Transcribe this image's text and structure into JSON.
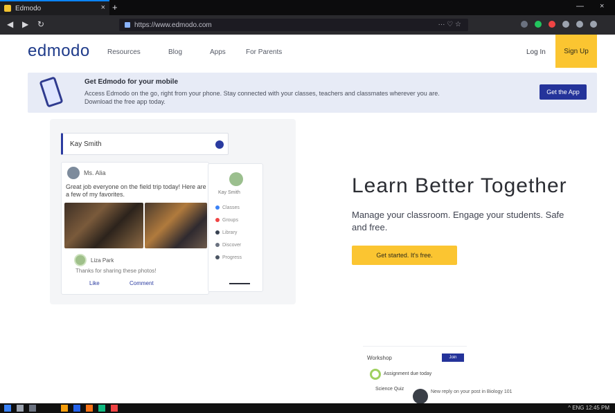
{
  "browser": {
    "tab_title": "Edmodo",
    "tab_close": "×",
    "new_tab": "+",
    "window_min": "—",
    "window_close": "×",
    "back": "◀",
    "forward": "▶",
    "reload": "↻",
    "url": "https://www.edmodo.com",
    "url_actions": "··· ♡ ☆"
  },
  "header": {
    "logo": "edmodo",
    "nav_links": [
      "Resources",
      "Blog",
      "Apps",
      "For Parents"
    ],
    "login": "Log In",
    "signup": "Sign Up"
  },
  "banner": {
    "title": "Get Edmodo for your mobile",
    "text": "Access Edmodo on the go, right from your phone. Stay connected with your classes, teachers and classmates wherever you are. Download the free app today.",
    "button": "Get the App"
  },
  "mock": {
    "search_text": "Kay Smith",
    "post_name": "Ms. Alia",
    "post_text": "Great job everyone on the field trip today! Here are a few of my favorites.",
    "comment_name": "Liza Park",
    "comment_text": "Thanks for sharing these photos!",
    "action_like": "Like",
    "action_comment": "Comment",
    "side_name": "Kay Smith",
    "side_items": [
      "Classes",
      "Groups",
      "Library",
      "Discover",
      "Progress"
    ]
  },
  "hero": {
    "title": "Learn Better Together",
    "subtitle": "Manage your classroom. Engage your students. Safe and free.",
    "button": "Get started. It's free."
  },
  "bottom": {
    "title": "Workshop",
    "badge": "Join",
    "ring_text": "Assignment due today",
    "row": "Science Quiz",
    "notif": "New reply on your post in Biology 101"
  },
  "taskbar": {
    "tray": "^  ENG  12:45 PM"
  }
}
